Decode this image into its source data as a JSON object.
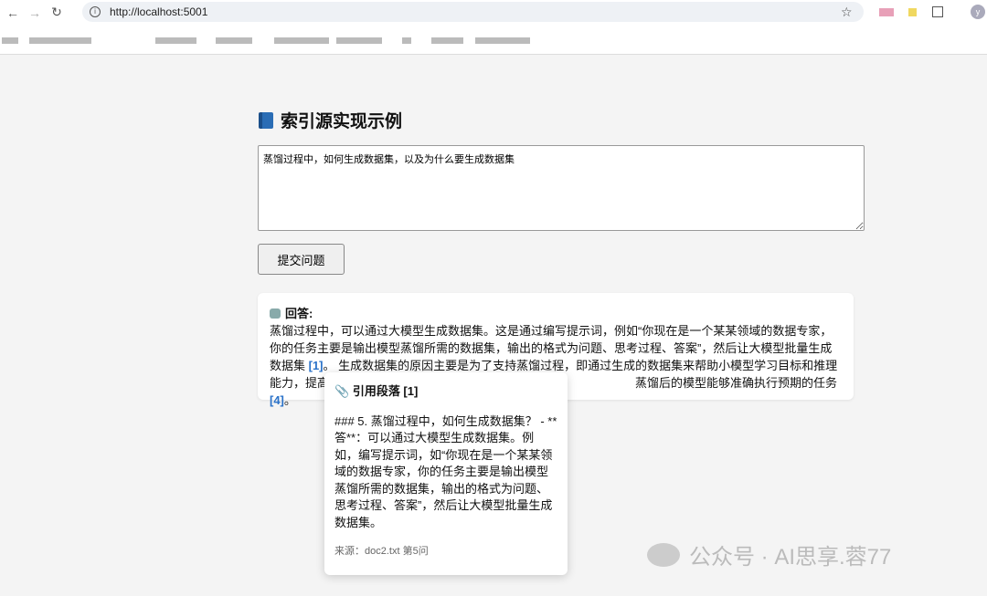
{
  "browser": {
    "url": "http://localhost:5001",
    "avatar": "y"
  },
  "page": {
    "title": "索引源实现示例",
    "question": "蒸馏过程中，如何生成数据集，以及为什么要生成数据集",
    "submit_label": "提交问题",
    "answer": {
      "heading": "回答:",
      "p1": "蒸馏过程中，可以通过大模型生成数据集。这是通过编写提示词，例如“你现在是一个某某领域的数据专家，你的任务主要是输出模型蒸馏所需的数据集，输出的格式为问题、思考过程、答案”，然后让大模型批量生成数据集 ",
      "cite1": "[1]",
      "p2": "。 生成数据集的原因主要是为了支持蒸馏过程，即通过生成的数据集来帮助小模型学习目标和推理能力，提高",
      "p3": "蒸馏后的模型能够准确执行预期的任务 ",
      "cite4": "[4]",
      "p4": "。"
    },
    "tooltip": {
      "title": "引用段落 [1]",
      "body": "### 5. 蒸馏过程中，如何生成数据集？ - **答**：可以通过大模型生成数据集。例如，编写提示词，如“你现在是一个某某领域的数据专家，你的任务主要是输出模型蒸馏所需的数据集，输出的格式为问题、思考过程、答案”，然后让大模型批量生成数据集。",
      "source": "来源：doc2.txt 第5问"
    }
  },
  "watermark": "公众号 · AI思享.蓉77"
}
